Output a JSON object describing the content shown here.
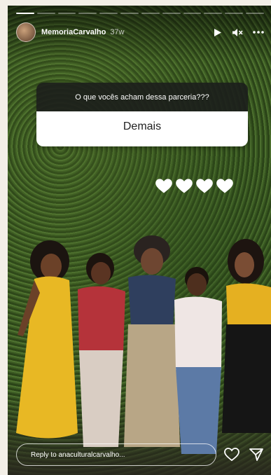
{
  "story": {
    "progress_segments": 12,
    "completed_segments": 1,
    "username": "MemoriaCarvalho",
    "time_ago": "37w"
  },
  "header_icons": [
    "play-icon",
    "mute-icon",
    "more-icon"
  ],
  "question_sticker": {
    "question": "O que vocês acham dessa parceria???",
    "answer": "Demais"
  },
  "hearts": {
    "count": 4,
    "color": "#ffffff"
  },
  "reply": {
    "placeholder": "Reply to anaculturalcarvalho..."
  },
  "footer_icons": [
    "heart-icon",
    "send-icon"
  ]
}
